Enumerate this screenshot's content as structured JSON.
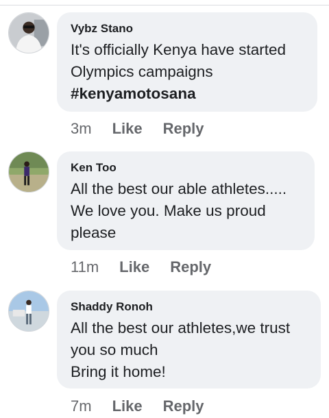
{
  "comments": [
    {
      "author": "Vybz Stano",
      "text": "It's officially Kenya have started Olympics campaigns",
      "hashtag": "#kenyamotosana",
      "time": "3m",
      "like_label": "Like",
      "reply_label": "Reply"
    },
    {
      "author": "Ken Too",
      "text": "All the best our able athletes.....\nWe love you. Make us proud please",
      "time": "11m",
      "like_label": "Like",
      "reply_label": "Reply"
    },
    {
      "author": "Shaddy Ronoh",
      "text": "All the best our athletes,we trust you so much\nBring it home!",
      "time": "7m",
      "like_label": "Like",
      "reply_label": "Reply"
    }
  ]
}
